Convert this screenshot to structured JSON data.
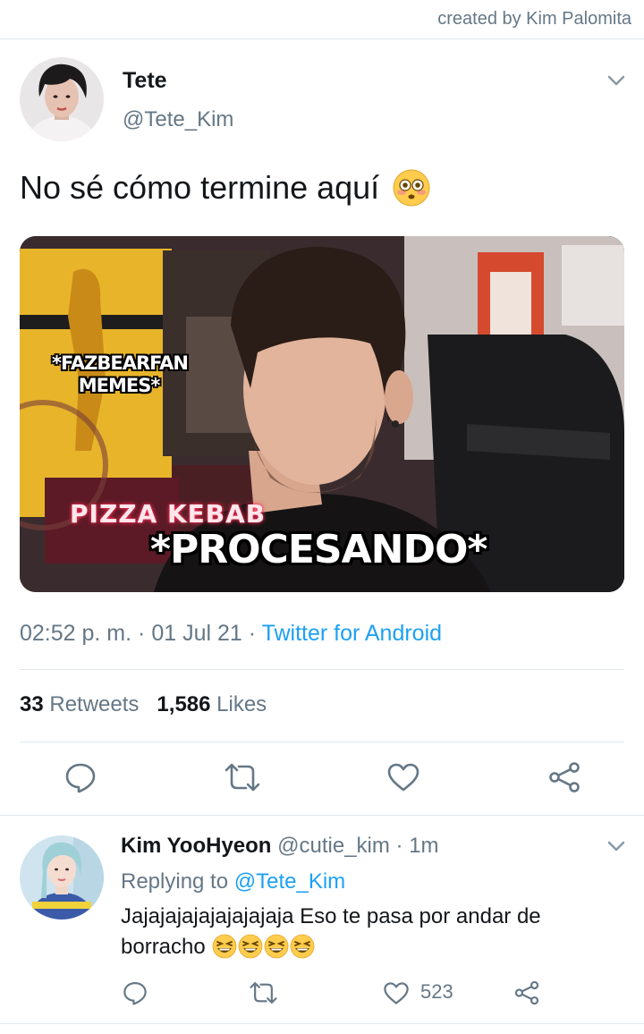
{
  "header": {
    "credit": "created by Kim Palomita"
  },
  "tweet": {
    "display_name": "Tete",
    "handle": "@Tete_Kim",
    "text": "No sé cómo termine aquí",
    "emoji": "flushed-face",
    "media": {
      "caption_top": "*FAZBEARFAN MEMES*",
      "caption_bottom": "*PROCESANDO*",
      "sign_text": "PIZZA KEBAB"
    },
    "time": "02:52 p. m.",
    "date": "01 Jul 21",
    "source": "Twitter for Android",
    "retweets_count": "33",
    "retweets_label": "Retweets",
    "likes_count": "1,586",
    "likes_label": "Likes"
  },
  "reply": {
    "display_name": "Kim YooHyeon",
    "handle": "@cutie_kim",
    "time": "1m",
    "replying_label": "Replying to",
    "replying_to": "@Tete_Kim",
    "text": "Jajajajajajajajajaja Eso te pasa por andar de borracho",
    "emojis": [
      "grinning-squinting-face",
      "grinning-squinting-face",
      "grinning-squinting-face",
      "grinning-squinting-face"
    ],
    "like_count": "523"
  },
  "colors": {
    "link": "#1da1f2",
    "secondary": "#657786",
    "text": "#14171a",
    "divider": "#e1e8ed"
  }
}
